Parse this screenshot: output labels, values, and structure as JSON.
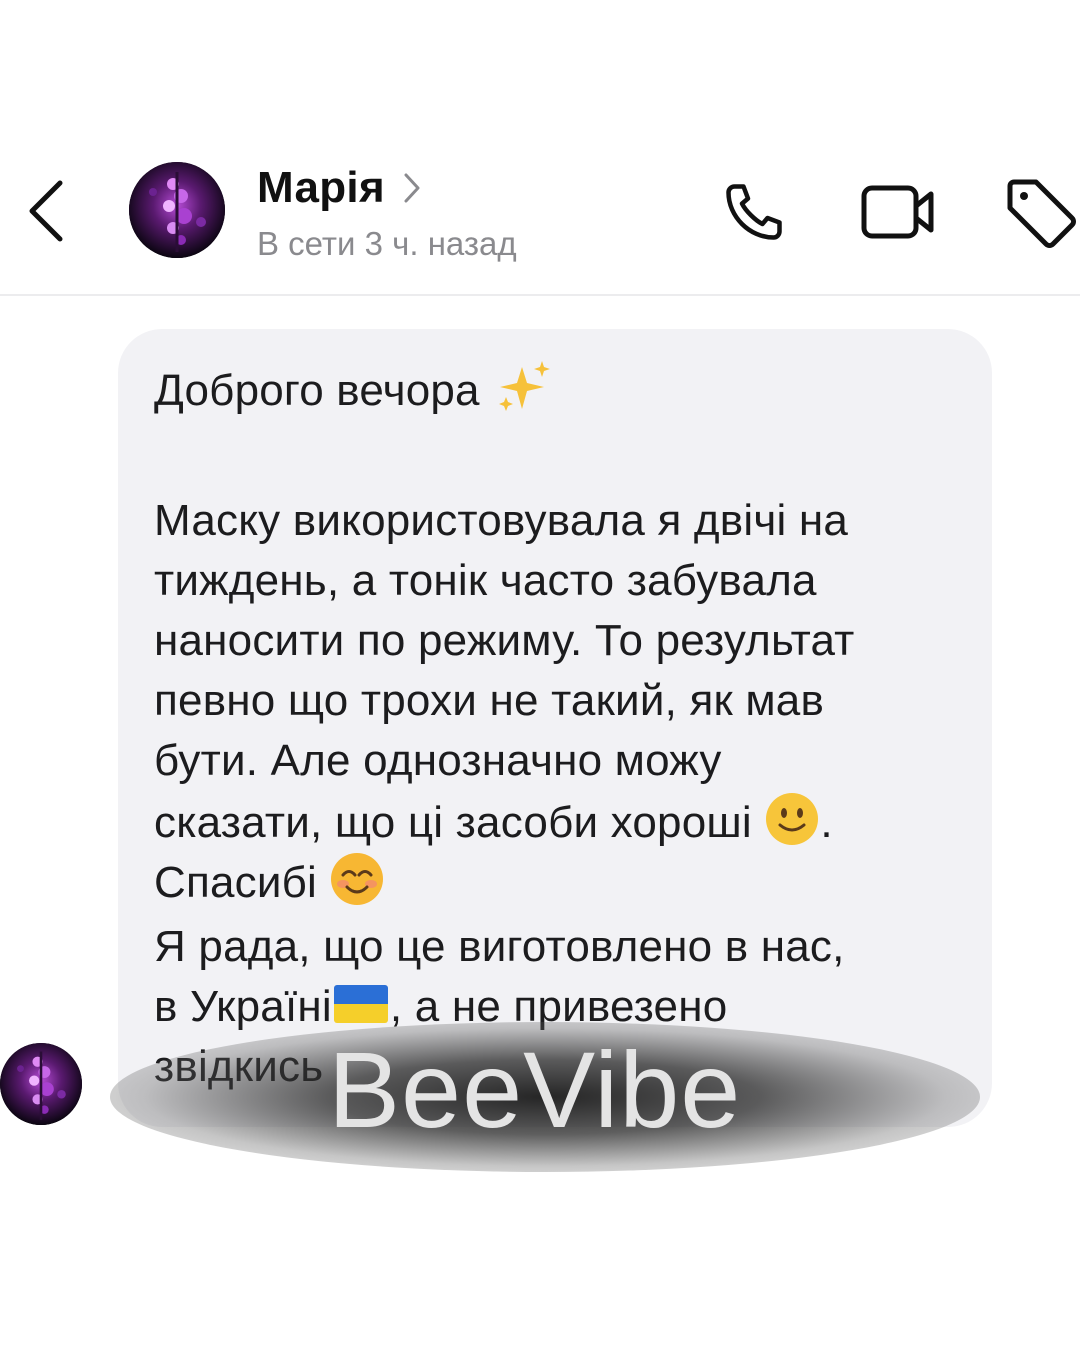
{
  "header": {
    "contact_name": "Марія",
    "status": "В сети 3 ч. назад",
    "icons": {
      "back": "chevron-left-icon",
      "name_chevron": "chevron-right-icon",
      "call": "phone-icon",
      "video": "video-camera-icon",
      "tag": "tag-icon"
    }
  },
  "message": {
    "lines": [
      "Доброго вечора",
      "Маску використовувала я двічі на",
      "тиждень, а тонік часто забувала",
      "наносити по режиму. То результат",
      "певно що трохи не такий, як мав",
      "бути. Але однозначно можу",
      "сказати, що ці засоби хороші",
      ".",
      "Спасибі",
      "Я рада, що це виготовлено в нас,",
      "в Україні",
      ", а не привезено",
      "звідкись"
    ],
    "emojis": [
      "sparkles-emoji",
      "slightly-smiling-face-emoji",
      "smiling-face-with-smiling-eyes-emoji",
      "ukraine-flag-emoji"
    ]
  },
  "watermark": {
    "text": "BeeVibe"
  },
  "colors": {
    "bubble_bg": "#f2f2f5",
    "status_text": "#8a8a8e",
    "text": "#1c1c1e"
  }
}
